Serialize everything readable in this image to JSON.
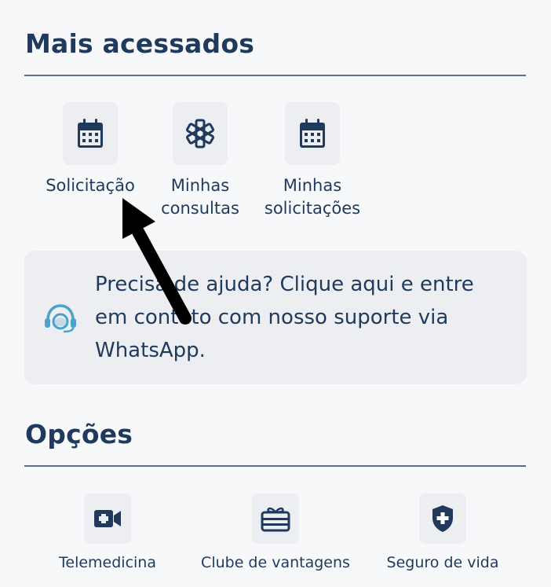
{
  "most_accessed": {
    "title": "Mais acessados",
    "items": [
      {
        "label": "Solicitação",
        "icon": "calendar-icon"
      },
      {
        "label": "Minhas\nconsultas",
        "icon": "medical-star-icon"
      },
      {
        "label": "Minhas\nsolicitações",
        "icon": "calendar-icon"
      }
    ]
  },
  "help": {
    "text": "Precisa de ajuda? Clique aqui e entre em contato com nosso suporte via WhatsApp.",
    "icon": "headset-icon"
  },
  "options": {
    "title": "Opções",
    "items": [
      {
        "label": "Telemedicina",
        "icon": "video-camera-icon"
      },
      {
        "label": "Clube de vantagens",
        "icon": "gift-card-icon"
      },
      {
        "label": "Seguro de vida",
        "icon": "shield-plus-icon"
      }
    ]
  },
  "colors": {
    "primary": "#1f3a5c",
    "tile_bg": "#eceef2",
    "page_bg": "#f7f8fa",
    "help_icon": "#4aa3c9"
  }
}
